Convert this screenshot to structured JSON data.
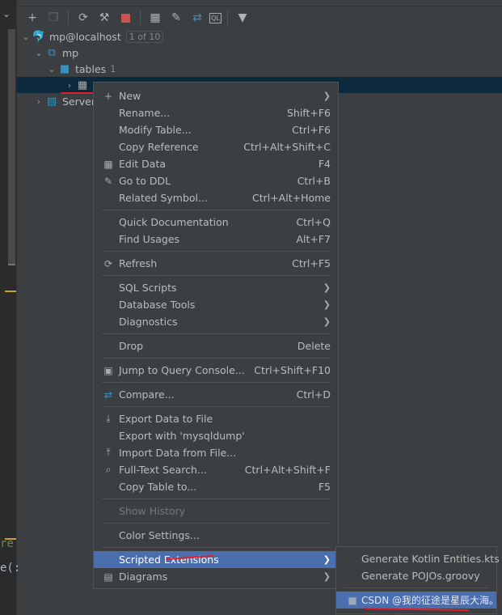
{
  "toolbar": {
    "icons": [
      "add-icon",
      "duplicate-icon",
      "refresh-icon",
      "db-tools-icon",
      "stop-icon",
      "table-icon",
      "edit-icon",
      "compare-icon",
      "console-icon",
      "filter-icon"
    ]
  },
  "tree": {
    "connection": {
      "label": "mp@localhost",
      "badge": "1 of 10"
    },
    "schema": {
      "label": "mp"
    },
    "tables": {
      "label": "tables",
      "count": "1"
    },
    "server": {
      "label": "Server"
    }
  },
  "editor": {
    "line1": "re",
    "line2": "e(:"
  },
  "menu": {
    "groups": [
      [
        {
          "label": "New",
          "submenu": true,
          "icon": "plus-icon"
        },
        {
          "label": "Rename...",
          "shortcut": "Shift+F6"
        },
        {
          "label": "Modify Table...",
          "shortcut": "Ctrl+F6"
        },
        {
          "label": "Copy Reference",
          "shortcut": "Ctrl+Alt+Shift+C"
        },
        {
          "label": "Edit Data",
          "shortcut": "F4",
          "icon": "table-icon"
        },
        {
          "label": "Go to DDL",
          "shortcut": "Ctrl+B",
          "icon": "edit-icon"
        },
        {
          "label": "Related Symbol...",
          "shortcut": "Ctrl+Alt+Home"
        }
      ],
      [
        {
          "label": "Quick Documentation",
          "shortcut": "Ctrl+Q"
        },
        {
          "label": "Find Usages",
          "shortcut": "Alt+F7"
        }
      ],
      [
        {
          "label": "Refresh",
          "shortcut": "Ctrl+F5",
          "icon": "refresh-icon"
        }
      ],
      [
        {
          "label": "SQL Scripts",
          "submenu": true
        },
        {
          "label": "Database Tools",
          "submenu": true
        },
        {
          "label": "Diagnostics",
          "submenu": true
        }
      ],
      [
        {
          "label": "Drop",
          "shortcut": "Delete"
        }
      ],
      [
        {
          "label": "Jump to Query Console...",
          "shortcut": "Ctrl+Shift+F10",
          "icon": "console-icon"
        }
      ],
      [
        {
          "label": "Compare...",
          "shortcut": "Ctrl+D",
          "icon": "compare-icon"
        }
      ],
      [
        {
          "label": "Export Data to File",
          "icon": "export-icon"
        },
        {
          "label": "Export with 'mysqldump'"
        },
        {
          "label": "Import Data from File...",
          "icon": "import-icon"
        },
        {
          "label": "Full-Text Search...",
          "shortcut": "Ctrl+Alt+Shift+F",
          "icon": "search-icon"
        },
        {
          "label": "Copy Table to...",
          "shortcut": "F5"
        }
      ],
      [
        {
          "label": "Show History",
          "disabled": true
        }
      ],
      [
        {
          "label": "Color Settings..."
        }
      ],
      [
        {
          "label": "Scripted Extensions",
          "submenu": true,
          "highlighted": true
        },
        {
          "label": "Diagrams",
          "submenu": true,
          "icon": "diagram-icon"
        }
      ]
    ]
  },
  "submenu": {
    "items": [
      {
        "label": "Generate Kotlin Entities.kts"
      },
      {
        "label": "Generate POJOs.groovy"
      }
    ],
    "highlighted_icon": "folder-icon"
  },
  "watermark": "CSDN @我的征途是星辰大海。",
  "colors": {
    "highlight": "#4b6eaf",
    "selected_row": "#0d293e",
    "annotation": "#e0202a"
  }
}
